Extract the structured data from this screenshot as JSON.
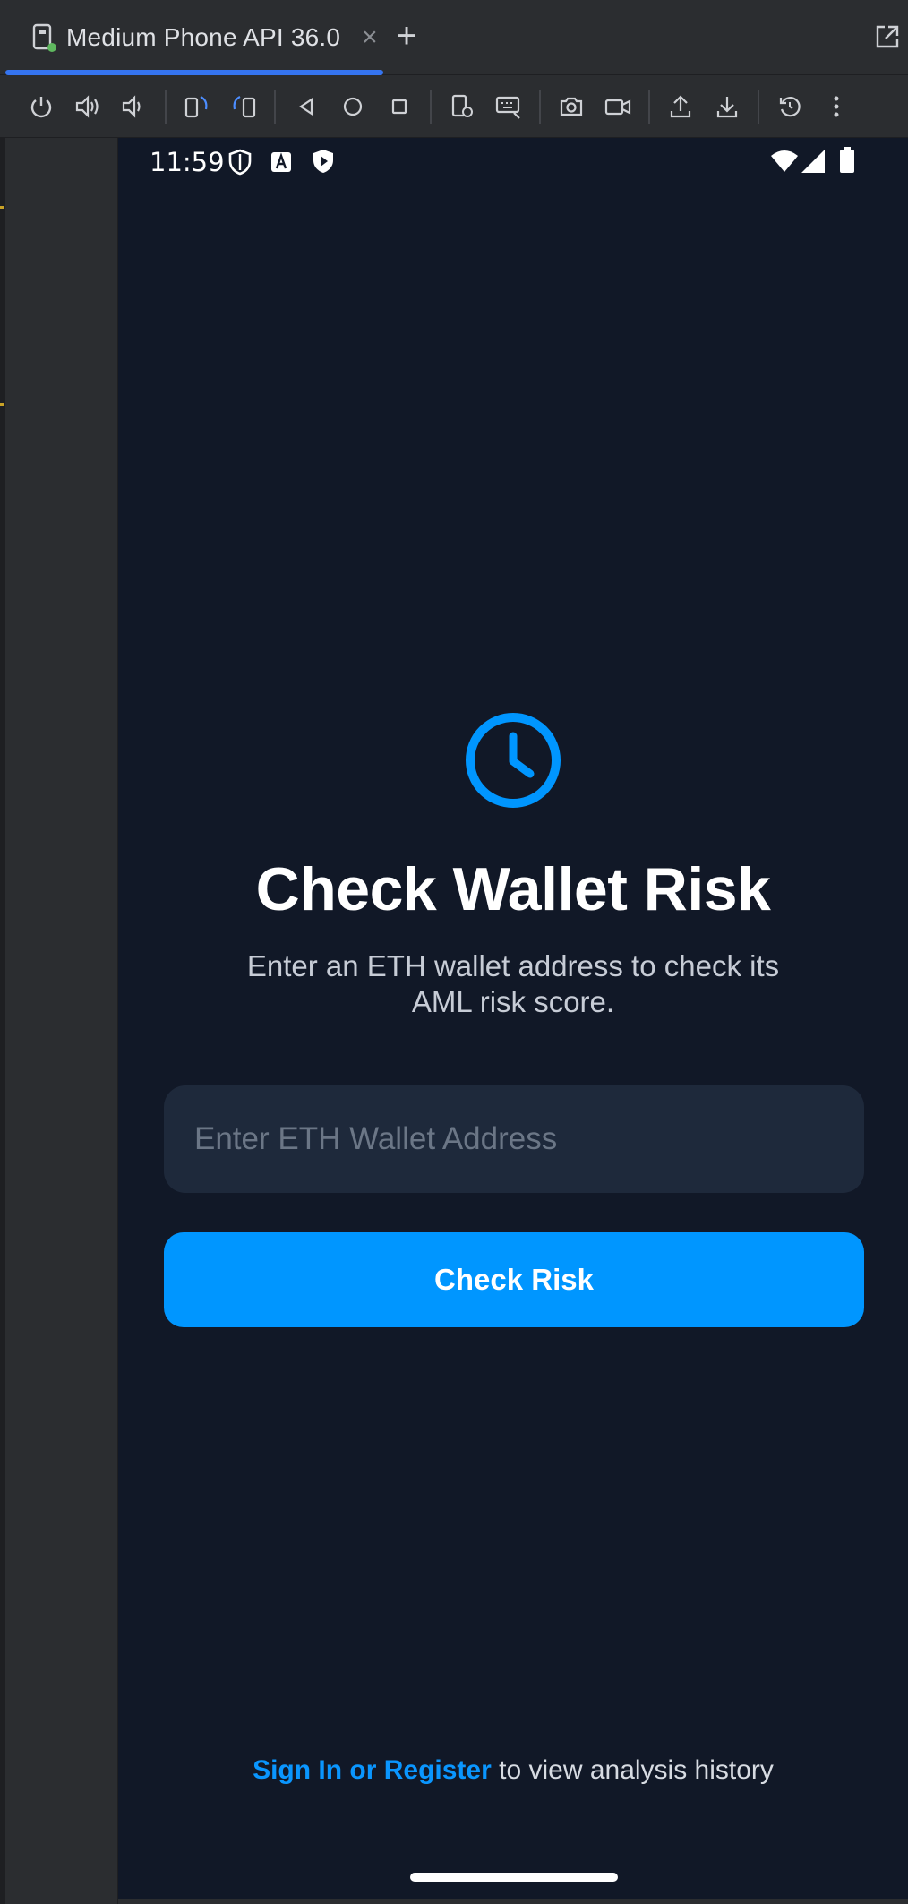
{
  "emulator": {
    "tab_title": "Medium Phone API 36.0",
    "tab_close": "×",
    "add_tab": "+",
    "toolbar_icons": [
      "power-icon",
      "volume-up-icon",
      "volume-down-icon",
      "rotate-left-icon",
      "rotate-right-icon",
      "back-icon",
      "home-icon",
      "overview-icon",
      "device-settings-icon",
      "keyboard-icon",
      "camera-icon",
      "video-icon",
      "upload-icon",
      "download-icon",
      "snapshot-icon",
      "more-icon"
    ],
    "accent": "#3574f0"
  },
  "status_bar": {
    "time": "11:59",
    "icons": [
      "privacy-shield-icon",
      "font-icon",
      "play-protect-icon",
      "wifi-icon",
      "signal-icon",
      "battery-icon"
    ]
  },
  "main": {
    "title": "Check Wallet Risk",
    "subtitle": "Enter an ETH wallet address to check its AML risk score.",
    "input_placeholder": "Enter ETH Wallet Address",
    "input_value": "",
    "button_label": "Check Risk",
    "footer_link": "Sign In or Register",
    "footer_text": " to view analysis history"
  },
  "colors": {
    "background": "#111827",
    "input_bg": "#1e293b",
    "primary": "#0096ff"
  }
}
